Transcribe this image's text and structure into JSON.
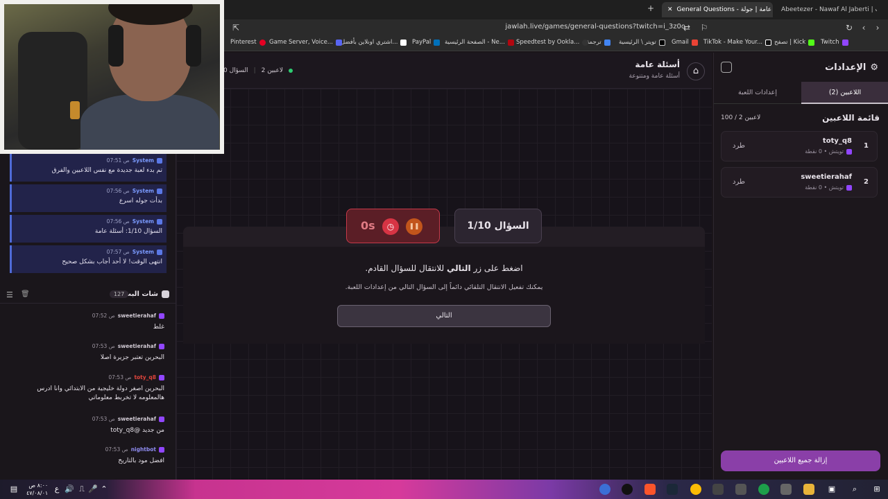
{
  "browser": {
    "tabs": [
      {
        "label": "General Questions - أسئلة عامة | جولة",
        "active": true
      },
      {
        "label": "Abeetezer - Nawaf Al Jaberti | بث",
        "active": false
      }
    ],
    "url": "jawlah.live/games/general-questions?twitch=i_3z0o",
    "bookmarks": [
      "Twitch",
      "تصفح | Kick",
      "TikTok - Make Your...",
      "Gmail",
      "تويتر \\ الرئيسية",
      "ترجمة",
      "Speedtest by Ookla...",
      "الصفحة الرئيسية - Ne...",
      "PayPal",
      "اشتري اونلاين بأفضل...",
      "Game Server, Voice...",
      "Pinterest"
    ]
  },
  "settings": {
    "title": "الإعدادات",
    "tabs": [
      "اللاعبين (2)",
      "إعدادات اللعبة"
    ],
    "list_title": "قائمة اللاعبين",
    "count": "100 / 2 لاعبين",
    "players": [
      {
        "num": "1",
        "name": "toty_q8",
        "meta": "تويتش • 0 نقطة",
        "kick": "طرد"
      },
      {
        "num": "2",
        "name": "sweetierahaf",
        "meta": "تويتش • 0 نقطة",
        "kick": "طرد"
      }
    ],
    "clear_button": "إزالة جميع اللاعبين"
  },
  "game": {
    "title": "أسئلة عامة",
    "subtitle": "أسئلة عامة ومتنوعة",
    "players_count": "2 لاعبين",
    "question_counter": "السؤال 0",
    "question_box": "السؤال 1/10",
    "timer": "0s",
    "msg_prefix": "اضغط على زر",
    "msg_bold": "التالي",
    "msg_suffix": "للانتقال للسؤال القادم.",
    "msg_hint": "يمكنك تفعيل الانتقال التلقائي دائماً إلى السؤال التالي من إعدادات اللعبة.",
    "next_button": "التالي"
  },
  "system_messages": [
    {
      "user": "System",
      "time": "07:51 ص",
      "text": "تم بدء لعبة جديدة مع نفس اللاعبين والفرق"
    },
    {
      "user": "System",
      "time": "07:56 ص",
      "text": "بدأت جوله اسرع"
    },
    {
      "user": "System",
      "time": "07:56 ص",
      "text": "السؤال 1/10: أسئلة عامة"
    },
    {
      "user": "System",
      "time": "07:57 ص",
      "text": "انتهى الوقت! لا أحد أجاب بشكل صحيح"
    }
  ],
  "chat": {
    "title": "شات البث",
    "count": "127",
    "messages": [
      {
        "user": "sweetierahaf",
        "time": "07:52 ص",
        "text": "غلط"
      },
      {
        "user": "sweetierahaf",
        "time": "07:53 ص",
        "text": "البحرين تعتبر جزيرة اصلا"
      },
      {
        "user": "toty_q8",
        "time": "07:53 ص",
        "text": "البحرين اصغر دولة خليجية من الابتدائي وانا ادرس",
        "text2": "هالمعلومه لا تخربط معلوماتي"
      },
      {
        "user": "sweetierahaf",
        "time": "07:53 ص",
        "text": "toty_q8@ من جديد"
      },
      {
        "user": "nightbot",
        "time": "07:53 ص",
        "text": "افضل مود بالتاريخ"
      }
    ]
  },
  "taskbar": {
    "clock_time": "٨:٠٠ ص",
    "clock_date": "٤٧/٠٨/٠١",
    "lang": "ع"
  },
  "colors": {
    "accent": "#8a3fa8",
    "timer_red": "#d73444",
    "twitch": "#9146ff"
  }
}
